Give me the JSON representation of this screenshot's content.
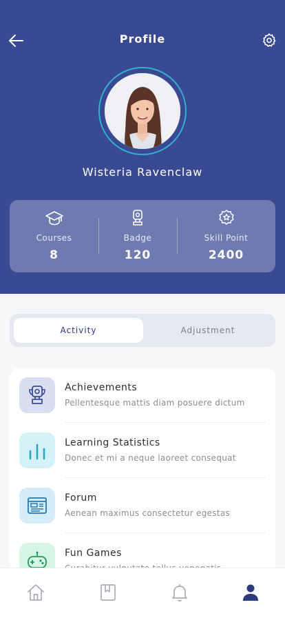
{
  "header": {
    "title": "Profile",
    "back_icon": "arrow-left-icon",
    "settings_icon": "gear-icon",
    "background": "#3a4a92"
  },
  "profile": {
    "name": "Wisteria Ravenclaw",
    "avatar": "avatar-photo"
  },
  "stats": [
    {
      "icon": "graduation-cap-icon",
      "label": "Courses",
      "value": "8"
    },
    {
      "icon": "trophy-icon",
      "label": "Badge",
      "value": "120"
    },
    {
      "icon": "star-badge-icon",
      "label": "Skill Point",
      "value": "2400"
    }
  ],
  "tabs": [
    {
      "label": "Activity",
      "active": true
    },
    {
      "label": "Adjustment",
      "active": false
    }
  ],
  "items": [
    {
      "icon": "trophy-icon",
      "title": "Achievements",
      "subtitle": "Pellentesque mattis diam posuere dictum",
      "color": "#d9def0"
    },
    {
      "icon": "bar-chart-icon",
      "title": "Learning Statistics",
      "subtitle": "Donec et mi a neque laoreet consequat",
      "color": "#d3f1f6"
    },
    {
      "icon": "browser-window-icon",
      "title": "Forum",
      "subtitle": "Aenean maximus consectetur egestas",
      "color": "#d5ecfa"
    },
    {
      "icon": "game-controller-icon",
      "title": "Fun Games",
      "subtitle": "Curabitur vulputate tellus venenatis",
      "color": "#d6f5e4"
    }
  ],
  "bottom_nav": [
    {
      "icon": "home-icon",
      "active": false
    },
    {
      "icon": "bookmark-icon",
      "active": false
    },
    {
      "icon": "bell-icon",
      "active": false
    },
    {
      "icon": "user-icon",
      "active": true
    }
  ],
  "colors": {
    "accent": "#2b3a7a",
    "ring": "#2fb3d1"
  }
}
